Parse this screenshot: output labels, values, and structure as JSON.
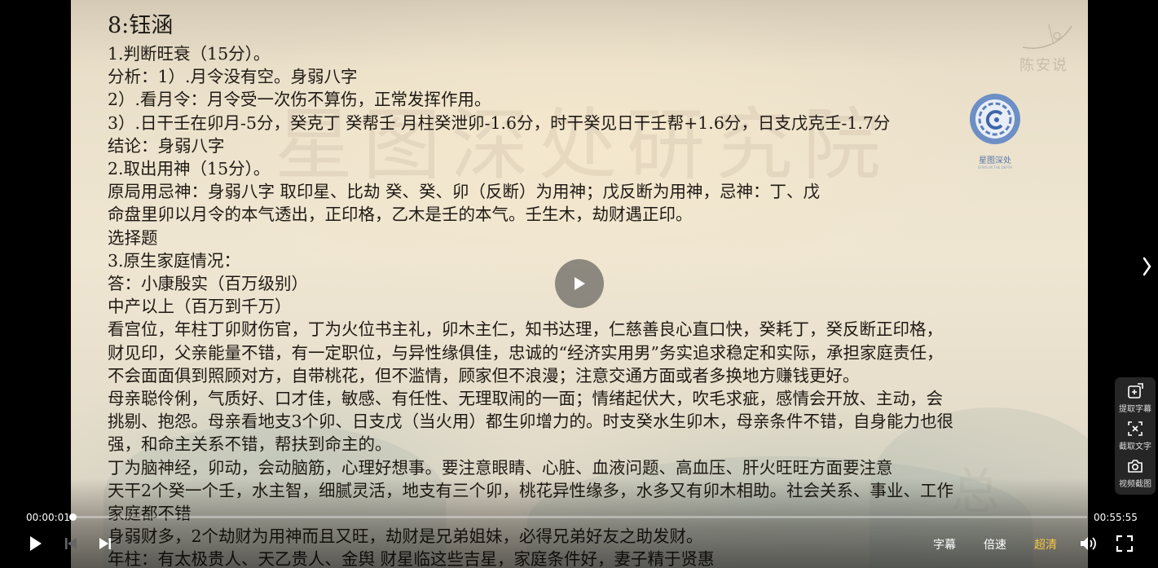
{
  "player": {
    "time_current": "00:00:01",
    "time_total": "00:55:55",
    "progress_fraction": 0.0003,
    "subtitle_label": "字幕",
    "speed_label": "倍速",
    "quality_label": "超清",
    "quality_color": "#f6c744"
  },
  "side_tools": [
    {
      "label": "提取字幕",
      "icon": "extract-subtitle-icon"
    },
    {
      "label": "截取文字",
      "icon": "text-capture-icon"
    },
    {
      "label": "视频截图",
      "icon": "camera-icon"
    }
  ],
  "video_frame": {
    "watermark_text": "星图深处研究院",
    "corner_signature": "陈安说",
    "logo_name": "星图深处",
    "logo_subtext": "STARS IN THE DEPTH",
    "bottom_faint_text": "总",
    "document": {
      "title": "8:钰涵",
      "lines": [
        "1.判断旺衰（15分）。",
        "分析：1）.月令没有空。身弱八字",
        "2）.看月令：月令受一次伤不算伤，正常发挥作用。",
        "3）.日干壬在卯月-5分，癸克丁 癸帮壬 月柱癸泄卯-1.6分，时干癸见日干壬帮+1.6分，日支戊克壬-1.7分",
        "结论：身弱八字",
        "2.取出用神（15分）。",
        "原局用忌神：身弱八字 取印星、比劫 癸、癸、卯（反断）为用神；戊反断为用神，忌神：丁、戊",
        "命盘里卯以月令的本气透出，正印格，乙木是壬的本气。壬生木，劫财遇正印。",
        "选择题",
        "3.原生家庭情况：",
        "答：小康殷实（百万级别）",
        "中产以上（百万到千万）",
        "看宫位，年柱丁卯财伤官，丁为火位书主礼，卯木主仁，知书达理，仁慈善良心直口快，癸耗丁，癸反断正印格，",
        "财见印，父亲能量不错，有一定职位，与异性缘俱佳，忠诚的“经济实用男”务实追求稳定和实际，承担家庭责任，",
        "不会面面俱到照顾对方，自带桃花，但不滥情，顾家但不浪漫；注意交通方面或者多换地方赚钱更好。",
        "母亲聪伶俐，气质好、口才佳，敏感、有任性、无理取闹的一面；情绪起伏大，吹毛求疵，感情会开放、主动，会",
        "挑剔、抱怨。母亲看地支3个卯、日支戊（当火用）都生卯增力的。时支癸水生卯木，母亲条件不错，自身能力也很",
        "强，和命主关系不错，帮扶到命主的。",
        "丁为脑神经，卯动，会动脑筋，心理好想事。要注意眼睛、心脏、血液问题、高血压、肝火旺旺方面要注意",
        "天干2个癸一个壬，水主智，细腻灵活，地支有三个卯，桃花异性缘多，水多又有卯木相助。社会关系、事业、工作",
        "家庭都不错",
        "身弱财多，2个劫财为用神而且又旺，劫财是兄弟姐妹，必得兄弟好友之助发财。",
        "年柱：有太极贵人、天乙贵人、金舆 财星临这些吉星，家庭条件好，妻子精于贤惠"
      ]
    }
  }
}
